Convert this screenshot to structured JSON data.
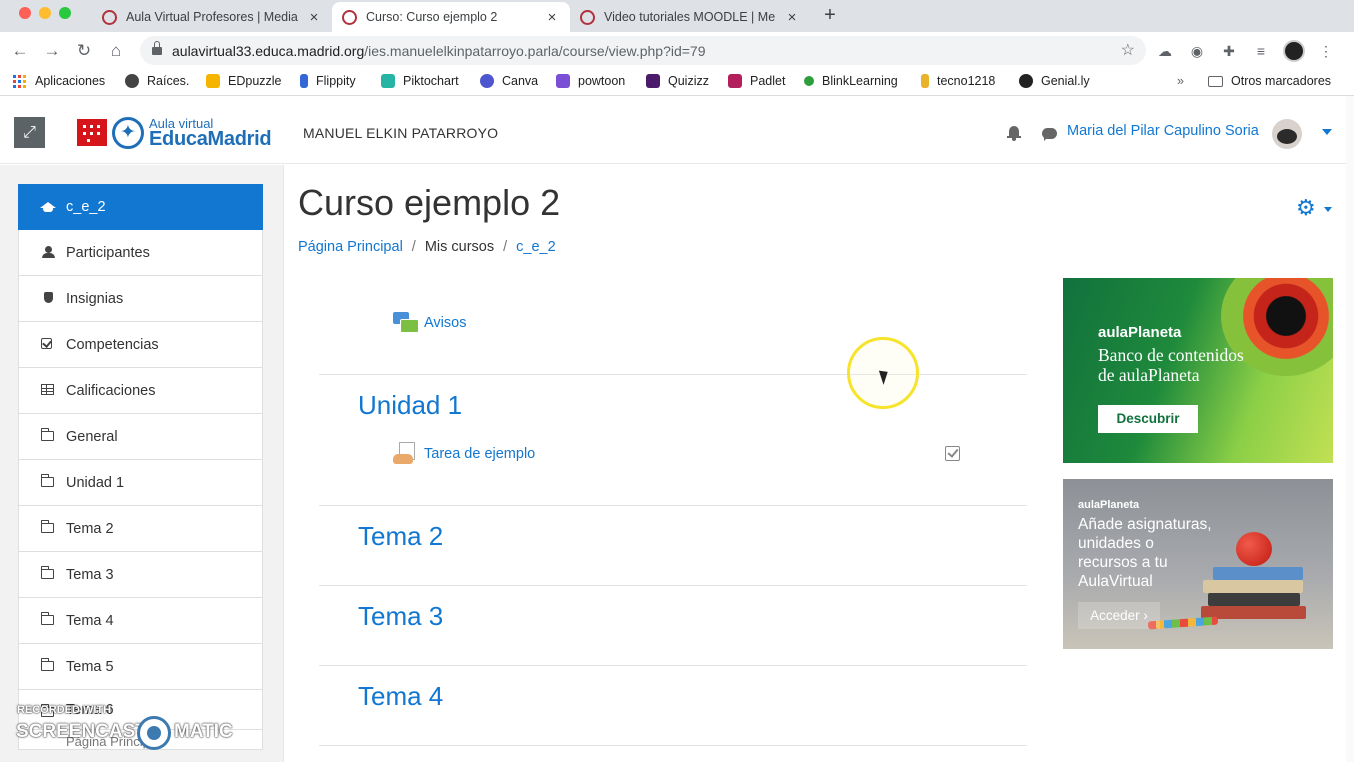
{
  "browser": {
    "tabs": [
      {
        "title": "Aula Virtual Profesores | Media",
        "active": false
      },
      {
        "title": "Curso: Curso ejemplo 2",
        "active": true
      },
      {
        "title": "Video tutoriales MOODLE | Me",
        "active": false
      }
    ],
    "close_glyph": "×",
    "new_tab_glyph": "+",
    "url_host": "aulavirtual33.educa.madrid.org",
    "url_path": "/ies.manuelelkinpatarroyo.parla/course/view.php?id=79",
    "bookmarks": [
      {
        "label": "Aplicaciones",
        "color": "#1a73e8"
      },
      {
        "label": "Raíces.",
        "color": "#333333"
      },
      {
        "label": "EDpuzzle",
        "color": "#f4b400"
      },
      {
        "label": "Flippity",
        "color": "#3367d6"
      },
      {
        "label": "Piktochart",
        "color": "#26b5a5"
      },
      {
        "label": "Canva",
        "color": "#4d55cf"
      },
      {
        "label": "powtoon",
        "color": "#7a4fd6"
      },
      {
        "label": "Quizizz",
        "color": "#4c1a6b"
      },
      {
        "label": "Padlet",
        "color": "#b31f5a"
      },
      {
        "label": "BlinkLearning",
        "color": "#2e9e3a"
      },
      {
        "label": "tecno1218",
        "color": "#e8b22a"
      },
      {
        "label": "Genial.ly",
        "color": "#222222"
      }
    ],
    "bookmarks_overflow": "»",
    "other_bookmarks": "Otros marcadores"
  },
  "header": {
    "logo_small": "Aula virtual",
    "logo_big": "EducaMadrid",
    "site_name": "MANUEL ELKIN PATARROYO",
    "user_name": "Maria del Pilar Capulino Soria"
  },
  "nav": {
    "items": [
      {
        "label": "c_e_2",
        "icon": "graduation-cap-icon"
      },
      {
        "label": "Participantes",
        "icon": "users-icon"
      },
      {
        "label": "Insignias",
        "icon": "shield-icon"
      },
      {
        "label": "Competencias",
        "icon": "check-square-icon"
      },
      {
        "label": "Calificaciones",
        "icon": "table-icon"
      },
      {
        "label": "General",
        "icon": "folder-icon"
      },
      {
        "label": "Unidad 1",
        "icon": "folder-icon"
      },
      {
        "label": "Tema 2",
        "icon": "folder-icon"
      },
      {
        "label": "Tema 3",
        "icon": "folder-icon"
      },
      {
        "label": "Tema 4",
        "icon": "folder-icon"
      },
      {
        "label": "Tema 5",
        "icon": "folder-icon"
      },
      {
        "label": "Tema 6",
        "icon": "folder-icon"
      },
      {
        "label": "Página Principal",
        "icon": "home-icon"
      }
    ]
  },
  "watermark": {
    "top": "RECORDED WITH",
    "left": "SCREENCAST",
    "right": "MATIC"
  },
  "main": {
    "course_title": "Curso ejemplo 2",
    "breadcrumb": [
      {
        "label": "Página Principal",
        "link": true
      },
      {
        "label": "Mis cursos",
        "link": false
      },
      {
        "label": "c_e_2",
        "link": true
      }
    ],
    "breadcrumb_sep": "/",
    "announcements": "Avisos",
    "sections": [
      {
        "title": "Unidad 1",
        "activities": [
          "Tarea de ejemplo"
        ]
      },
      {
        "title": "Tema 2",
        "activities": []
      },
      {
        "title": "Tema 3",
        "activities": []
      },
      {
        "title": "Tema 4",
        "activities": []
      }
    ]
  },
  "ads": {
    "ad1": {
      "brand": "aulaPlaneta",
      "line1": "Banco de contenidos",
      "line2": "de aulaPlaneta",
      "button": "Descubrir"
    },
    "ad2": {
      "brand": "aulaPlaneta",
      "line1": "Añade asignaturas,",
      "line2": "unidades o",
      "line3": "recursos a tu",
      "line4": "AulaVirtual",
      "button": "Acceder ›"
    }
  }
}
